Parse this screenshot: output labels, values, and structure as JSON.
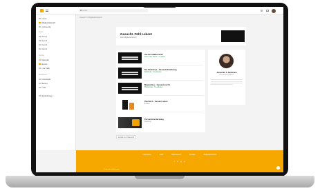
{
  "topbar": {
    "search_placeholder": "Suche"
  },
  "sidebar": {
    "items": [
      {
        "label": "Home"
      },
      {
        "label": "Mitgliederbereich"
      },
      {
        "label": "Community"
      }
    ],
    "section_1": "Kurse",
    "section_1_items": [
      {
        "label": "Kurs 1"
      },
      {
        "label": "Kurs 2"
      },
      {
        "label": "Kurs 3"
      },
      {
        "label": "Kurs 4"
      }
    ],
    "section_2": "Termine",
    "section_2_items": [
      {
        "label": "Kalender"
      },
      {
        "label": "Events"
      },
      {
        "label": "Live Calls"
      }
    ],
    "section_3": "Ressourcen",
    "section_3_items": [
      {
        "label": "Downloads"
      },
      {
        "label": "Bücher"
      },
      {
        "label": "Links"
      }
    ],
    "footer_item": "Einstellungen"
  },
  "breadcrumb": "Gesucht in Mitgliederbereich",
  "hero": {
    "title": "Gesucht. Fühl Leben!",
    "subtitle": "Dein Mitgliederbereich"
  },
  "products": [
    {
      "title": "Herzlich Willkommen",
      "meta": "Dein erster Schritt · 1 Lektion",
      "meta_grey": false
    },
    {
      "title": "Der Workshop · Gesunde Ernährung",
      "meta": "Workshop · 6 Lektionen",
      "meta_grey": false
    },
    {
      "title": "Masterclass · Gesund und fit",
      "meta": "Masterclass · 8 Lektionen",
      "meta_grey": false
    },
    {
      "title": "Das Buch · Gesund Leben",
      "meta": "E-Book",
      "meta_grey": true
    },
    {
      "title": "Persönliche Beratung",
      "meta": "Coaching",
      "meta_grey": true
    }
  ],
  "profile": {
    "name": "Alexander S. Kaufmann",
    "role": "Dein Ansprechpartner"
  },
  "back_button": "Zurück zur Übersicht",
  "footer": {
    "links": [
      "Impressum",
      "AGB",
      "Datenschutz",
      "Kontakt",
      "Mitgliederbereich"
    ],
    "social": [
      "f",
      "in",
      "ig",
      "yt"
    ],
    "copyright": "© Gesucht. Fühl Leben"
  },
  "colors": {
    "accent": "#f6a700",
    "sidebar_bg": "#ffffff",
    "content_bg": "#f3f3f3"
  }
}
